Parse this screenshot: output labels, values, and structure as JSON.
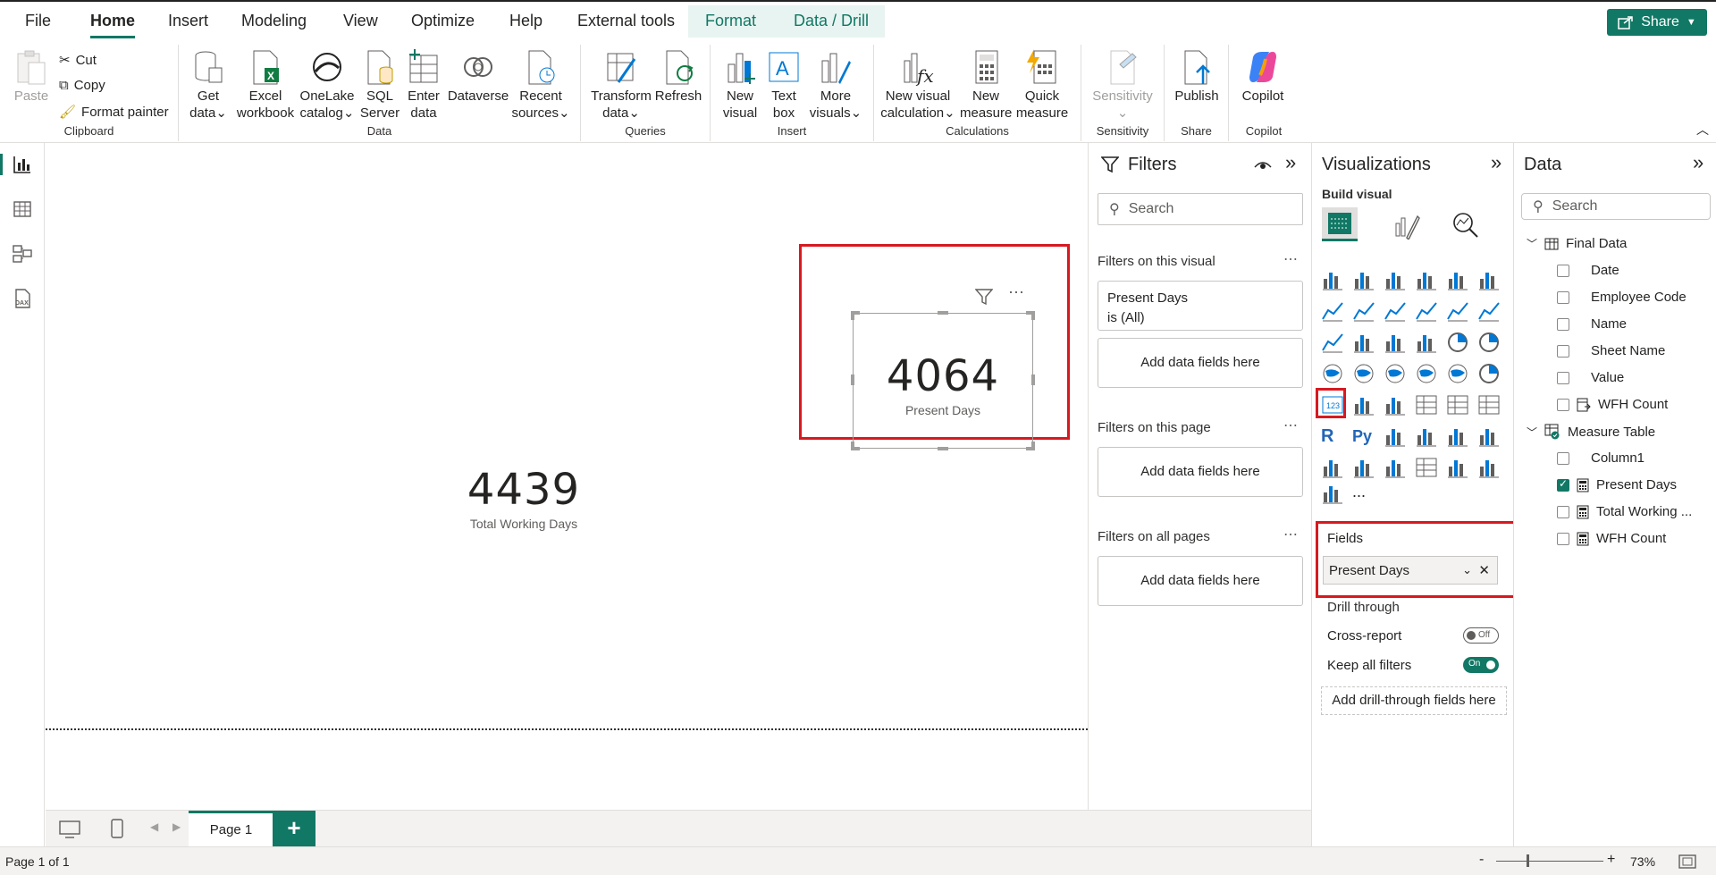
{
  "menu": {
    "items": [
      "File",
      "Home",
      "Insert",
      "Modeling",
      "View",
      "Optimize",
      "Help",
      "External tools"
    ],
    "context_tabs": [
      "Format",
      "Data / Drill"
    ],
    "share_label": "Share"
  },
  "ribbon": {
    "clipboard": {
      "paste": "Paste",
      "cut": "Cut",
      "copy": "Copy",
      "format_painter": "Format painter",
      "label": "Clipboard"
    },
    "data": {
      "get_data_1": "Get",
      "get_data_2": "data",
      "excel_1": "Excel",
      "excel_2": "workbook",
      "onelake_1": "OneLake",
      "onelake_2": "catalog",
      "sql_1": "SQL",
      "sql_2": "Server",
      "enter_1": "Enter",
      "enter_2": "data",
      "dataverse_1": "Dataverse",
      "recent_1": "Recent",
      "recent_2": "sources",
      "label": "Data"
    },
    "queries": {
      "transform_1": "Transform",
      "transform_2": "data",
      "refresh": "Refresh",
      "label": "Queries"
    },
    "insert": {
      "new_visual_1": "New",
      "new_visual_2": "visual",
      "text_box_1": "Text",
      "text_box_2": "box",
      "more_1": "More",
      "more_2": "visuals",
      "label": "Insert"
    },
    "calculations": {
      "nvc_1": "New visual",
      "nvc_2": "calculation",
      "nm_1": "New",
      "nm_2": "measure",
      "qm_1": "Quick",
      "qm_2": "measure",
      "label": "Calculations"
    },
    "sensitivity": {
      "btn": "Sensitivity",
      "label": "Sensitivity"
    },
    "share": {
      "publish": "Publish",
      "label": "Share"
    },
    "copilot": {
      "btn": "Copilot",
      "label": "Copilot"
    }
  },
  "canvas": {
    "card1": {
      "value": "4439",
      "label": "Total Working Days"
    },
    "card2": {
      "value": "4064",
      "label": "Present Days"
    }
  },
  "pagebar": {
    "page_tab": "Page 1",
    "add": "+"
  },
  "status": {
    "page_info": "Page 1 of 1",
    "zoom": "73%"
  },
  "filters": {
    "title": "Filters",
    "search_placeholder": "Search",
    "on_visual": "Filters on this visual",
    "filter_card_1": "Present Days",
    "filter_card_2": "is (All)",
    "add_fields": "Add data fields here",
    "on_page": "Filters on this page",
    "on_all": "Filters on all pages"
  },
  "visualizations": {
    "title": "Visualizations",
    "build_visual": "Build visual",
    "fields_label": "Fields",
    "field_value": "Present Days",
    "drill_through": "Drill through",
    "cross_report": "Cross-report",
    "cross_report_state": "Off",
    "keep_filters": "Keep all filters",
    "keep_filters_state": "On",
    "add_drill": "Add drill-through fields here",
    "more": "..."
  },
  "data": {
    "title": "Data",
    "search_placeholder": "Search",
    "tables": [
      {
        "name": "Final Data",
        "fields": [
          "Date",
          "Employee Code",
          "Name",
          "Sheet Name",
          "Value",
          "WFH Count"
        ]
      },
      {
        "name": "Measure Table",
        "fields": [
          "Column1",
          "Present Days",
          "Total Working ...",
          "WFH Count"
        ]
      }
    ]
  }
}
